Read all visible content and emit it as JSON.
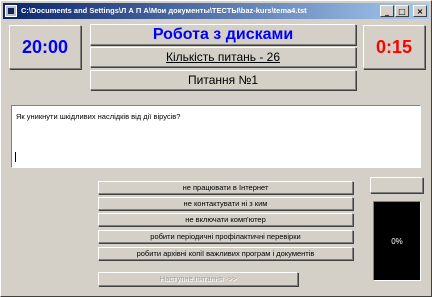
{
  "window": {
    "title": "C:\\Documents and Settings\\Л А П А\\Мои документы\\ТЕСТЫ\\baz-kurs\\tema4.tst",
    "minimize_glyph": "_",
    "maximize_glyph": "□",
    "close_glyph": "×"
  },
  "header": {
    "elapsed_time": "20:00",
    "remaining_time": "0:15",
    "title": "Робота з дисками",
    "question_count": "Кількість питань - 26",
    "question_number": "Питання №1",
    "colors": {
      "elapsed": "#0000ff",
      "remaining": "#ff0000",
      "title": "#0000ff"
    }
  },
  "question": {
    "text": "Як уникнути шкідливих наслідків від дії вірусів?"
  },
  "answers": [
    {
      "label": "не працювати в Інтернет"
    },
    {
      "label": "не контактувати ні з ким"
    },
    {
      "label": "не включати комп'ютер"
    },
    {
      "label": "робити періодичні профілактичні перевірки"
    },
    {
      "label": "робити архівні копії важливих програм і документів"
    }
  ],
  "next_button": {
    "label": "Наступне питання ->>",
    "enabled": false
  },
  "progress": {
    "label": "0%",
    "value": 0
  }
}
